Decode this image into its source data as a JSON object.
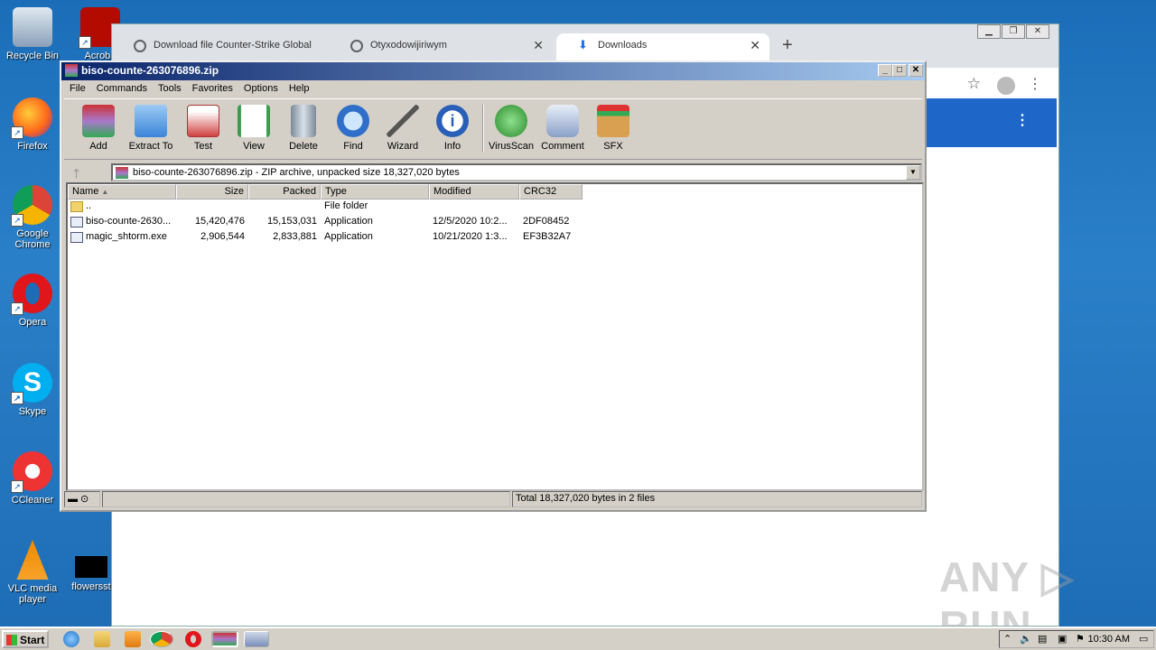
{
  "desktop": {
    "icons": [
      {
        "label": "Recycle Bin"
      },
      {
        "label": "Acroba"
      },
      {
        "label": "Firefox"
      },
      {
        "label": "Google Chrome"
      },
      {
        "label": "Opera"
      },
      {
        "label": "Skype"
      },
      {
        "label": "CCleaner"
      },
      {
        "label": "VLC media player"
      },
      {
        "label": "flowersst"
      }
    ]
  },
  "chrome": {
    "tabs": [
      {
        "label": "Download file Counter-Strike Global"
      },
      {
        "label": "Otyxodowijiriwym"
      },
      {
        "label": "Downloads"
      }
    ],
    "new_tab": "+"
  },
  "winrar": {
    "title": "biso-counte-263076896.zip",
    "menu": [
      "File",
      "Commands",
      "Tools",
      "Favorites",
      "Options",
      "Help"
    ],
    "toolbar": [
      {
        "label": "Add",
        "color": "#b7402c"
      },
      {
        "label": "Extract To",
        "color": "#4a90d9"
      },
      {
        "label": "Test",
        "color": "#d04040"
      },
      {
        "label": "View",
        "color": "#3c9a4c"
      },
      {
        "label": "Delete",
        "color": "#8a9aa8"
      },
      {
        "label": "Find",
        "color": "#2f6fc9"
      },
      {
        "label": "Wizard",
        "color": "#7a9a8a"
      },
      {
        "label": "Info",
        "color": "#2a5fb8"
      },
      {
        "label": "VirusScan",
        "color": "#3aa03a"
      },
      {
        "label": "Comment",
        "color": "#7a8fb0"
      },
      {
        "label": "SFX",
        "color": "#c88a3a"
      }
    ],
    "path": "biso-counte-263076896.zip - ZIP archive, unpacked size 18,327,020 bytes",
    "columns": {
      "name": "Name",
      "size": "Size",
      "packed": "Packed",
      "type": "Type",
      "modified": "Modified",
      "crc": "CRC32"
    },
    "rows": [
      {
        "name": "..",
        "size": "",
        "packed": "",
        "type": "File folder",
        "modified": "",
        "crc": "",
        "folder": true
      },
      {
        "name": "biso-counte-2630...",
        "size": "15,420,476",
        "packed": "15,153,031",
        "type": "Application",
        "modified": "12/5/2020 10:2...",
        "crc": "2DF08452"
      },
      {
        "name": "magic_shtorm.exe",
        "size": "2,906,544",
        "packed": "2,833,881",
        "type": "Application",
        "modified": "10/21/2020 1:3...",
        "crc": "EF3B32A7"
      }
    ],
    "status": "Total 18,327,020 bytes in 2 files"
  },
  "taskbar": {
    "start": "Start",
    "clock": "10:30 AM"
  },
  "watermark": "ANY ▷ RUN"
}
